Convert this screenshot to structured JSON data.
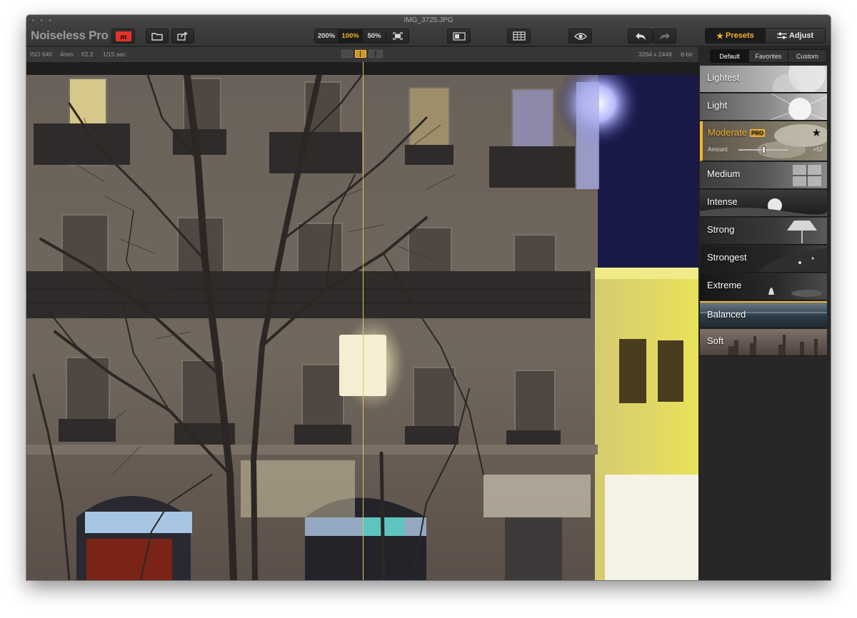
{
  "window": {
    "title": "IMG_3725.JPG"
  },
  "toolbar": {
    "app_name": "Noiseless Pro",
    "zoom": [
      "200%",
      "100%",
      "50%"
    ],
    "active_zoom": "100%",
    "presets_tab": "Presets",
    "adjust_tab": "Adjust"
  },
  "info": {
    "iso": "ISO 640",
    "focal": "4mm",
    "aperture": "f/2.2",
    "shutter": "1/15 sec",
    "dimensions": "3264 x 2448",
    "bitdepth": "8-bit"
  },
  "sidebar": {
    "segments": [
      "Default",
      "Favorites",
      "Custom"
    ],
    "active_segment": "Default",
    "presets": [
      "Lightest",
      "Light",
      "Moderate",
      "Medium",
      "Intense",
      "Strong",
      "Strongest",
      "Extreme",
      "Balanced",
      "Soft"
    ],
    "selected_preset": "Moderate",
    "pro_badge": "PRO",
    "amount_label": "Amount",
    "amount_value": "+52",
    "amount_fraction": 0.5
  },
  "colors": {
    "accent": "#f2b232",
    "brand_red": "#e0332c"
  }
}
